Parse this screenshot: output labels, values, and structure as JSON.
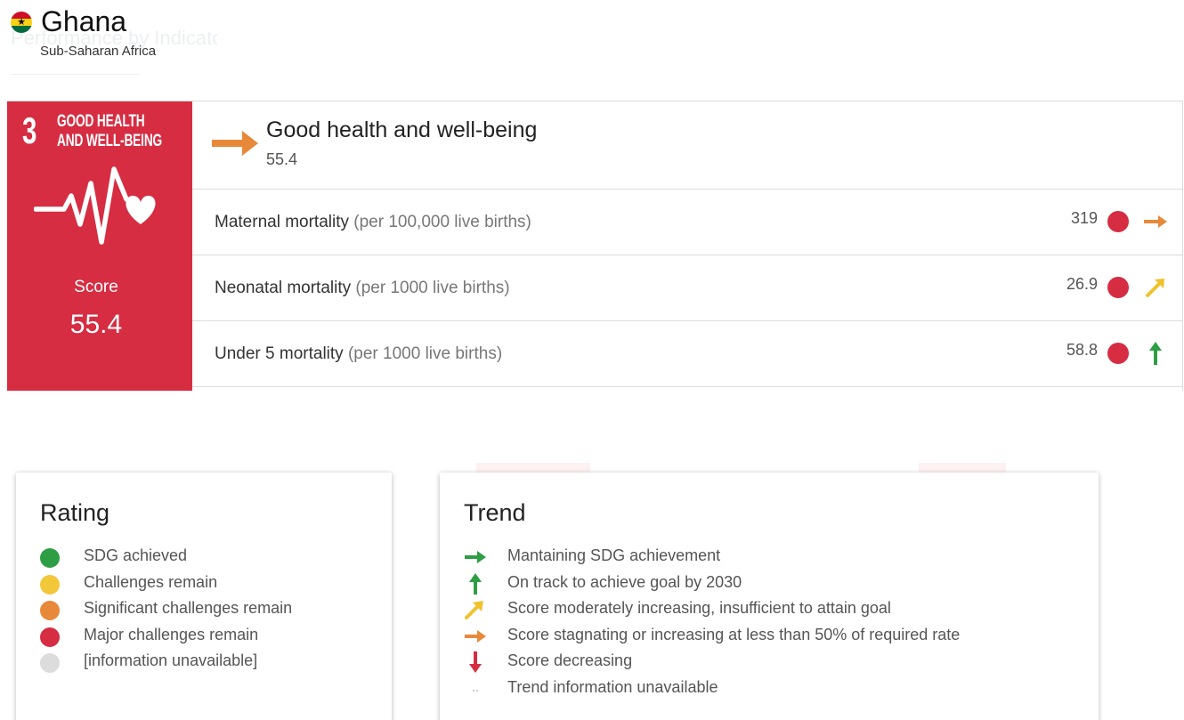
{
  "header": {
    "background_heading": "Performance by Indicator",
    "country": "Ghana",
    "region": "Sub-Saharan Africa",
    "flag_icon": "ghana-flag-icon"
  },
  "goal": {
    "number": "3",
    "tile_name_line1": "GOOD HEALTH",
    "tile_name_line2": "AND WELL-BEING",
    "tile_color": "#d62d42",
    "tile_icon": "heartbeat-icon",
    "score_label": "Score",
    "score": "55.4",
    "title": "Good health and well-being",
    "trend_icon": "arrow-right-icon",
    "trend_color": "#e8893a"
  },
  "indicators": [
    {
      "name": "Maternal mortality",
      "unit": "(per 100,000 live births)",
      "value": "319",
      "rating_color": "#d62d42",
      "trend": "arrow-right-icon",
      "trend_color": "#e8893a"
    },
    {
      "name": "Neonatal mortality",
      "unit": "(per 1000 live births)",
      "value": "26.9",
      "rating_color": "#d62d42",
      "trend": "arrow-up-right-icon",
      "trend_color": "#f0c22b"
    },
    {
      "name": "Under 5 mortality",
      "unit": "(per 1000 live births)",
      "value": "58.8",
      "rating_color": "#d62d42",
      "trend": "arrow-up-icon",
      "trend_color": "#2e9e44"
    }
  ],
  "rating_legend": {
    "title": "Rating",
    "items": [
      {
        "label": "SDG achieved",
        "color": "#2e9e44"
      },
      {
        "label": "Challenges remain",
        "color": "#f3c73a"
      },
      {
        "label": "Significant challenges remain",
        "color": "#e8893a"
      },
      {
        "label": "Major challenges remain",
        "color": "#d62d42"
      },
      {
        "label": "[information unavailable]",
        "color": "#dcdcdc"
      }
    ]
  },
  "trend_legend": {
    "title": "Trend",
    "items": [
      {
        "label": "Mantaining SDG achievement",
        "icon": "arrow-right-icon",
        "color": "#2e9e44"
      },
      {
        "label": "On track to achieve goal by 2030",
        "icon": "arrow-up-icon",
        "color": "#2e9e44"
      },
      {
        "label": "Score moderately increasing, insufficient to attain goal",
        "icon": "arrow-up-right-icon",
        "color": "#f0c22b"
      },
      {
        "label": "Score stagnating or increasing at less than 50% of required rate",
        "icon": "arrow-right-icon",
        "color": "#e8893a"
      },
      {
        "label": "Score decreasing",
        "icon": "arrow-down-icon",
        "color": "#d62d42"
      },
      {
        "label": "Trend information unavailable",
        "icon": "dots-icon",
        "color": "#bbbbbb"
      }
    ]
  }
}
